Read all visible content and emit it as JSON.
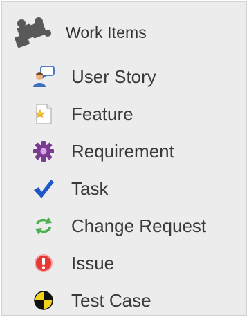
{
  "header": {
    "label": "Work Items",
    "icon": "puzzle-icon"
  },
  "items": [
    {
      "label": "User Story",
      "icon": "user-story-icon"
    },
    {
      "label": "Feature",
      "icon": "feature-icon"
    },
    {
      "label": "Requirement",
      "icon": "requirement-icon"
    },
    {
      "label": "Task",
      "icon": "task-icon"
    },
    {
      "label": "Change Request",
      "icon": "change-request-icon"
    },
    {
      "label": "Issue",
      "icon": "issue-icon"
    },
    {
      "label": "Test Case",
      "icon": "test-case-icon"
    }
  ],
  "colors": {
    "panel_background": "#ececec",
    "text": "#3a3a3a",
    "puzzle": "#595959",
    "requirement": "#7b3b93",
    "task": "#1d58c8",
    "change_request": "#4caf50",
    "issue": "#e53935",
    "test_case": "#f2d21b"
  }
}
